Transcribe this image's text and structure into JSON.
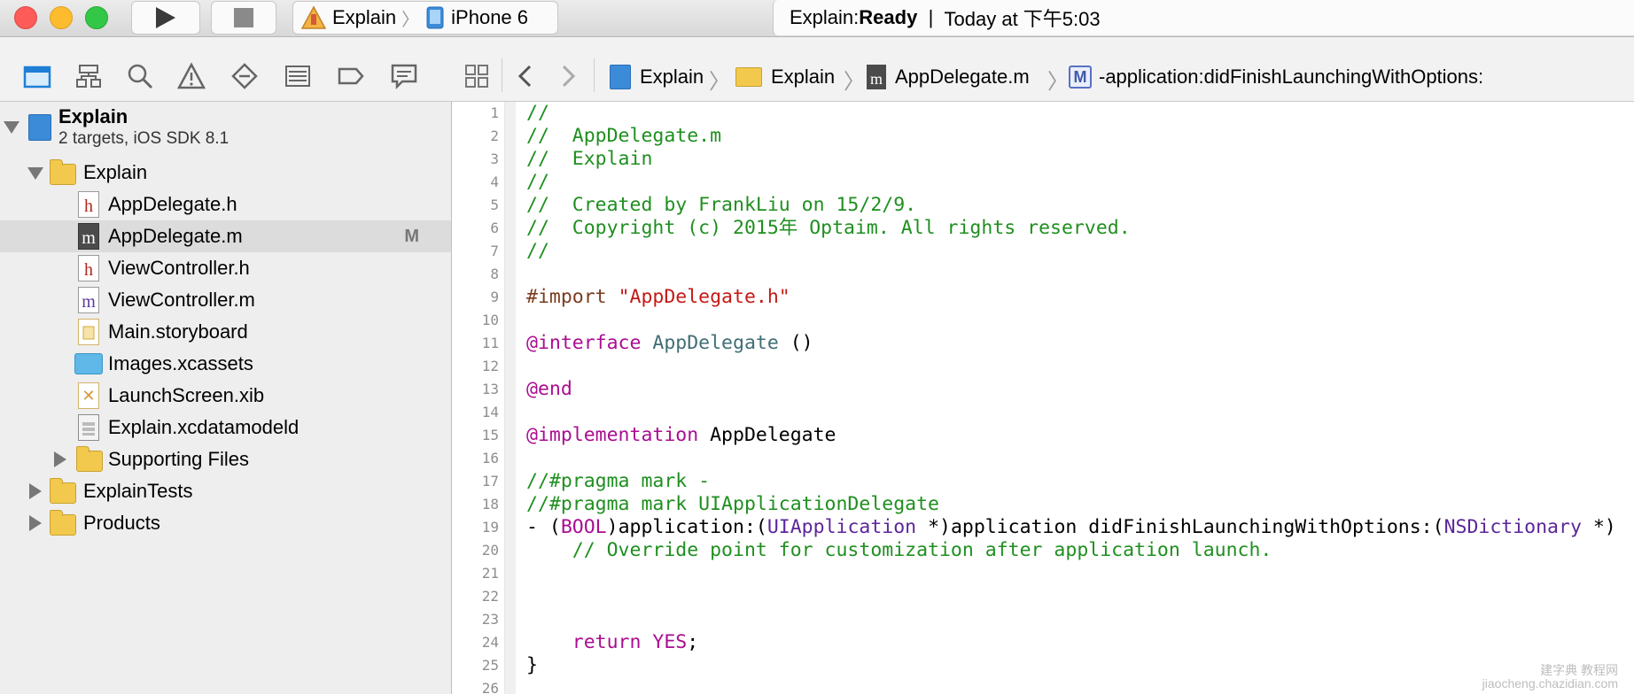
{
  "titlebar": {
    "scheme": {
      "project": "Explain",
      "device": "iPhone 6"
    },
    "activity": {
      "prefix": "Explain: ",
      "status": "Ready",
      "separator": "|",
      "time": "Today at 下午5:03"
    }
  },
  "navigator_toolbar": {
    "icons": [
      "folder-icon",
      "hierarchy-icon",
      "search-icon",
      "warning-icon",
      "breakpoint-diamond-icon",
      "list-icon",
      "tag-icon",
      "comment-icon"
    ]
  },
  "navigator": {
    "project": {
      "name": "Explain",
      "subtitle": "2 targets, iOS SDK 8.1"
    },
    "items": [
      {
        "label": "Explain",
        "kind": "folder"
      },
      {
        "label": "AppDelegate.h",
        "kind": "h"
      },
      {
        "label": "AppDelegate.m",
        "kind": "m",
        "badge": "M"
      },
      {
        "label": "ViewController.h",
        "kind": "h"
      },
      {
        "label": "ViewController.m",
        "kind": "m"
      },
      {
        "label": "Main.storyboard",
        "kind": "storyboard"
      },
      {
        "label": "Images.xcassets",
        "kind": "assets"
      },
      {
        "label": "LaunchScreen.xib",
        "kind": "xib"
      },
      {
        "label": "Explain.xcdatamodeld",
        "kind": "xcdatamodel"
      },
      {
        "label": "Supporting Files",
        "kind": "folder"
      },
      {
        "label": "ExplainTests",
        "kind": "folder"
      },
      {
        "label": "Products",
        "kind": "folder"
      }
    ]
  },
  "jumpbar": {
    "crumbs": [
      "Explain",
      "Explain",
      "AppDelegate.m",
      "-application:didFinishLaunchingWithOptions:"
    ],
    "method_badge": "M"
  },
  "editor": {
    "line_numbers": [
      "1",
      "2",
      "3",
      "4",
      "5",
      "6",
      "7",
      "8",
      "9",
      "10",
      "11",
      "12",
      "13",
      "14",
      "15",
      "16",
      "17",
      "18",
      "19",
      "20",
      "21",
      "22",
      "23",
      "24",
      "25",
      "26"
    ],
    "lines": {
      "l1": "//",
      "l2": "//  AppDelegate.m",
      "l3": "//  Explain",
      "l4": "//",
      "l5": "//  Created by FrankLiu on 15/2/9.",
      "l6": "//  Copyright (c) 2015年 Optaim. All rights reserved.",
      "l7": "//",
      "l9_import": "#import ",
      "l9_str": "\"AppDelegate.h\"",
      "l11_kw": "@interface",
      "l11_cls": " AppDelegate",
      "l11_rest": " ()",
      "l13_kw": "@end",
      "l15_kw": "@implementation",
      "l15_rest": " AppDelegate",
      "l17": "//#pragma mark -",
      "l18": "//#pragma mark UIApplicationDelegate",
      "l19_a": "- (",
      "l19_bool": "BOOL",
      "l19_b": ")application:(",
      "l19_uiapp": "UIApplication",
      "l19_c": " *)application didFinishLaunchingWithOptions:(",
      "l19_dict": "NSDictionary",
      "l19_d": " *)",
      "l20": "    // Override point for customization after application launch.",
      "l24_kw": "    return",
      "l24_yes": " YES",
      "l24_end": ";",
      "l25": "}"
    }
  },
  "watermark": {
    "line1": "建字典 教程网",
    "line2": "jiaocheng.chazidian.com"
  }
}
